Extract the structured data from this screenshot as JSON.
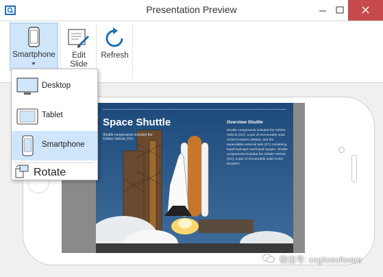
{
  "window": {
    "title": "Presentation Preview"
  },
  "ribbon": {
    "device_button_label": "Smartphone",
    "edit_label_line1": "Edit",
    "edit_label_line2": "Slide",
    "refresh_label": "Refresh"
  },
  "device_menu": {
    "items": [
      {
        "label": "Desktop",
        "icon": "desktop-icon"
      },
      {
        "label": "Tablet",
        "icon": "tablet-icon"
      },
      {
        "label": "Smartphone",
        "icon": "smartphone-icon",
        "selected": true
      }
    ],
    "rotate_label": "Rotate"
  },
  "slide": {
    "title": "Space Shuttle",
    "subtitle": "Shuttle components included the Orbiter Vehicle (OV)",
    "overview_title": "Overview Shuttle",
    "overview_text": "Shuttle components included the Orbiter Vehicle (OV), a pair of recoverable solid rocket boosters (SRBs), and the expendable external tank (ET) containing liquid hydrogen and liquid oxygen. Shuttle components included the Orbiter Vehicle (OV), a pair of recoverable solid rocket boosters."
  },
  "watermark": {
    "text": "微信号: cogitosoftware"
  },
  "colors": {
    "selected_bg": "#cfe5f9",
    "selected_border": "#9ccbf0",
    "icon_blue": "#1f6fb5",
    "close_red": "#c74b4b"
  }
}
